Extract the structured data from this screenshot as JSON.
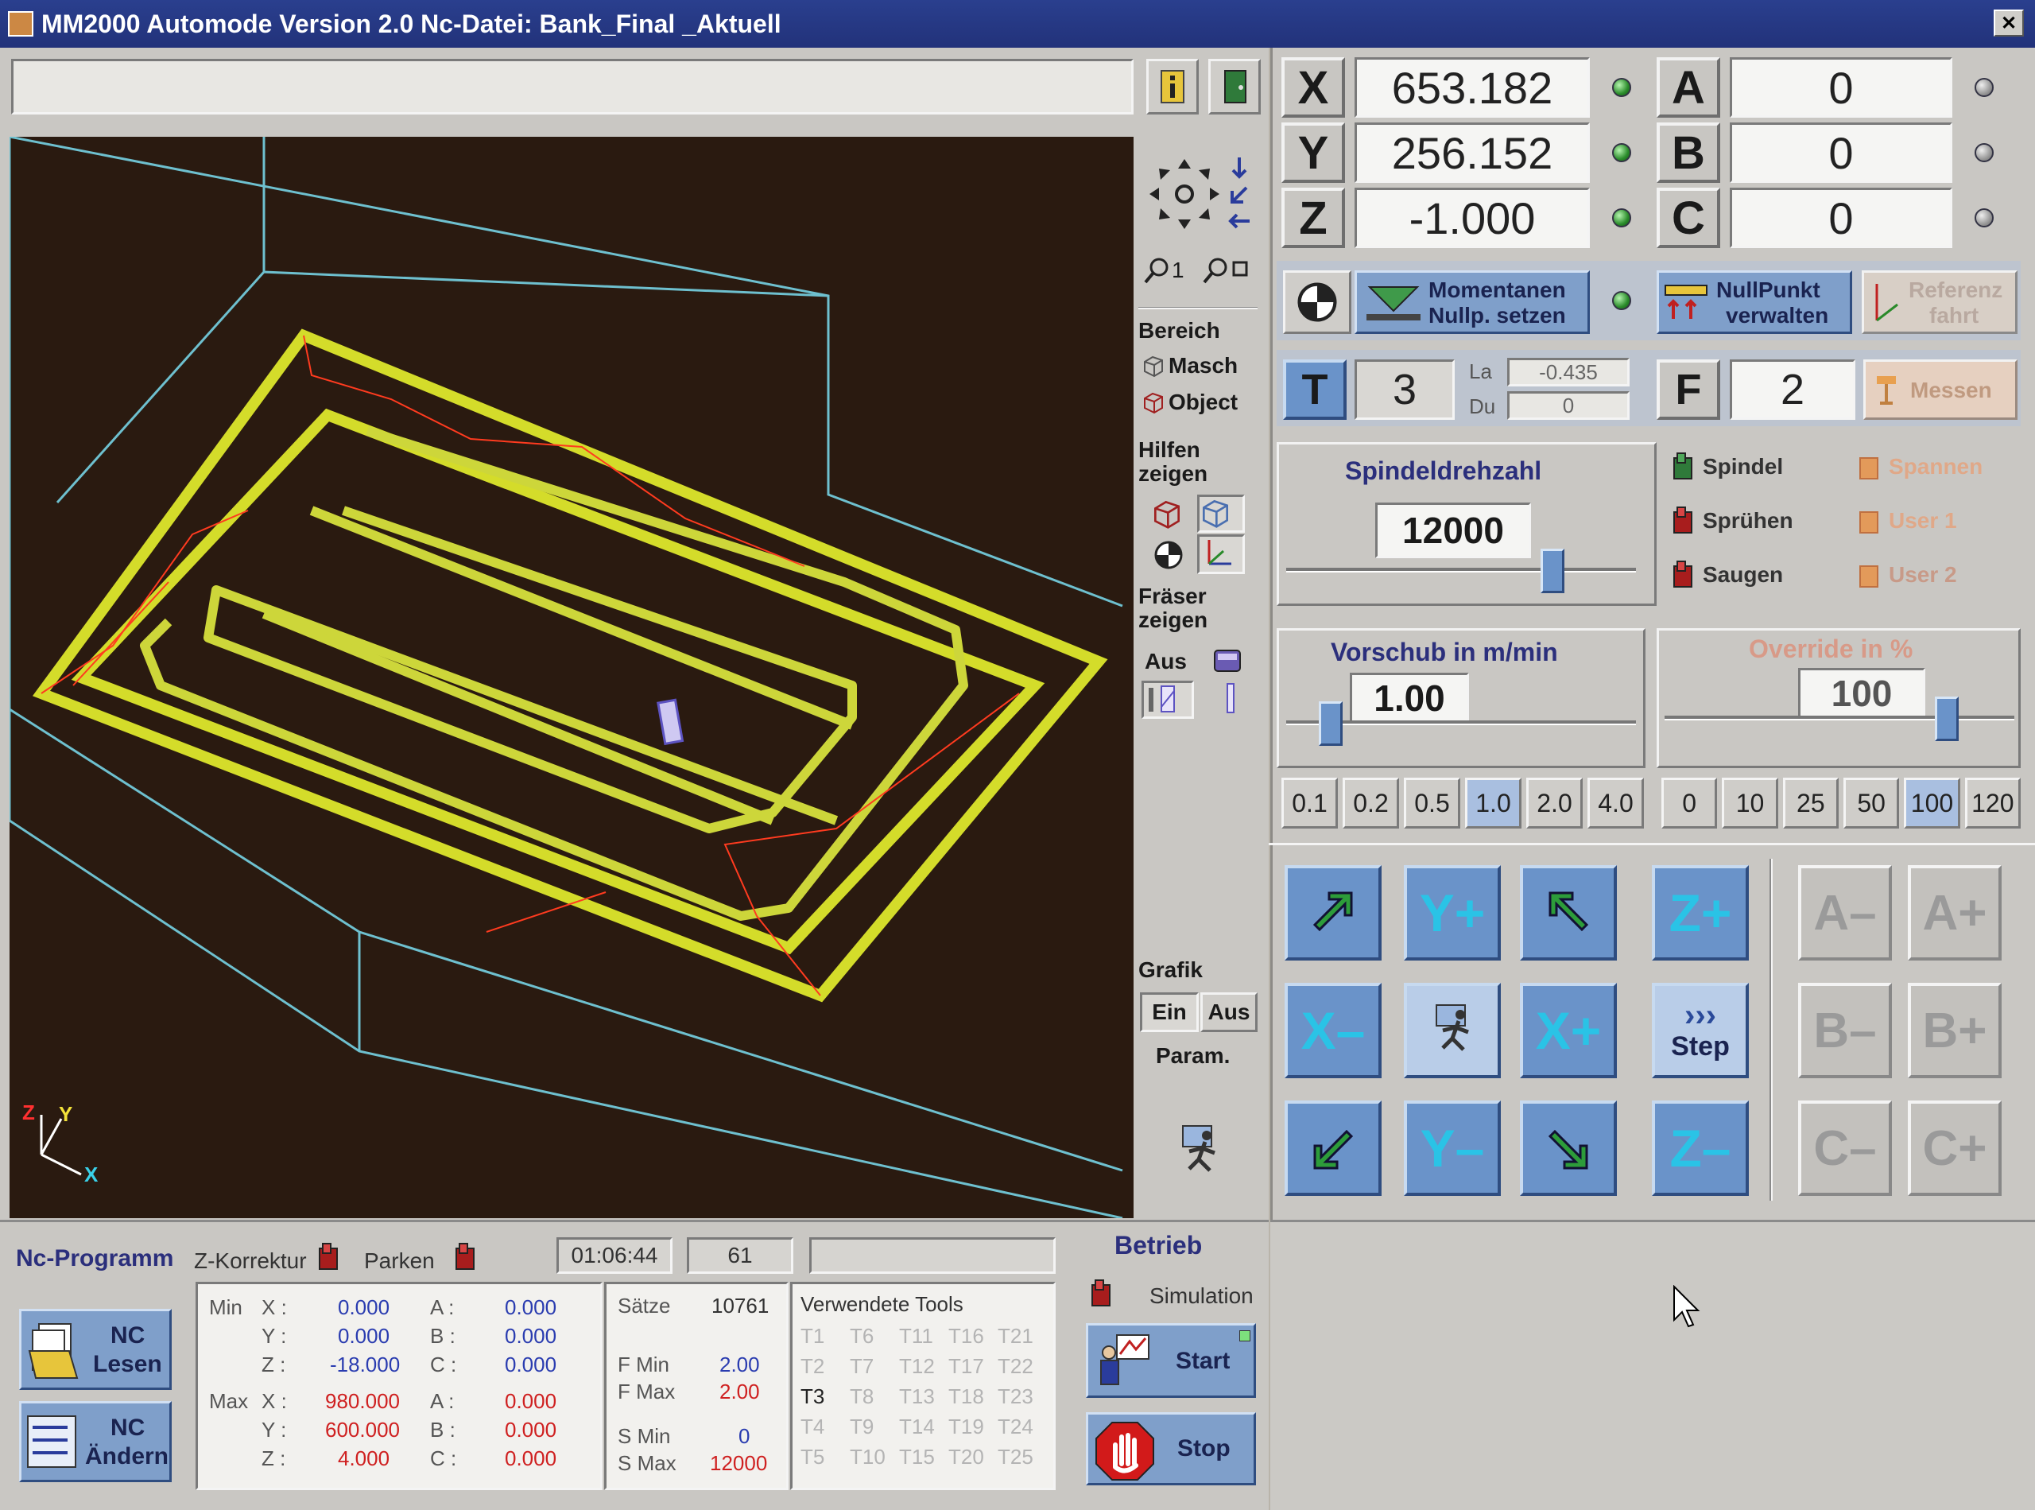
{
  "window": {
    "title": "MM2000 Automode Version 2.0 Nc-Datei: Bank_Final _Aktuell",
    "close_label": "✕"
  },
  "coords": {
    "x": {
      "label": "X",
      "value": "653.182"
    },
    "y": {
      "label": "Y",
      "value": "256.152"
    },
    "z": {
      "label": "Z",
      "value": "-1.000"
    },
    "a": {
      "label": "A",
      "value": "0"
    },
    "b": {
      "label": "B",
      "value": "0"
    },
    "c": {
      "label": "C",
      "value": "0"
    }
  },
  "zero": {
    "set_line1": "Momentanen",
    "set_line2": "Nullp. setzen",
    "manage_line1": "NullPunkt",
    "manage_line2": "verwalten",
    "ref_line1": "Referenz",
    "ref_line2": "fahrt"
  },
  "tool": {
    "t_label": "T",
    "t_value": "3",
    "la_label": "La",
    "la_value": "-0.435",
    "du_label": "Du",
    "du_value": "0",
    "f_label": "F",
    "f_value": "2",
    "measure_label": "Messen"
  },
  "spindle": {
    "title": "Spindeldrehzahl",
    "value": "12000",
    "slider_fraction": 0.78
  },
  "outputs": {
    "spindel": "Spindel",
    "spruehen": "Sprühen",
    "saugen": "Saugen",
    "spannen": "Spannen",
    "user1": "User 1",
    "user2": "User 2"
  },
  "feed": {
    "title": "Vorschub in m/min",
    "value": "1.00",
    "slider_fraction": 0.1,
    "presets": [
      "0.1",
      "0.2",
      "0.5",
      "1.0",
      "2.0",
      "4.0"
    ],
    "selected": "1.0"
  },
  "override": {
    "title": "Override in %",
    "value": "100",
    "slider_fraction": 0.83,
    "presets": [
      "0",
      "10",
      "25",
      "50",
      "100",
      "120"
    ],
    "selected": "100"
  },
  "jog": {
    "y_plus": "Y+",
    "y_minus": "Y–",
    "x_plus": "X+",
    "x_minus": "X–",
    "z_plus": "Z+",
    "z_minus": "Z–",
    "step_arrows": "›››",
    "step": "Step",
    "a_minus": "A–",
    "a_plus": "A+",
    "b_minus": "B–",
    "b_plus": "B+",
    "c_minus": "C–",
    "c_plus": "C+"
  },
  "view_tools": {
    "bereich": "Bereich",
    "masch": "Masch",
    "object": "Object",
    "hilfen1": "Hilfen",
    "hilfen2": "zeigen",
    "fraeser1": "Fräser",
    "fraeser2": "zeigen",
    "aus": "Aus",
    "zoom1": "1",
    "grafik": "Grafik",
    "ein": "Ein",
    "aus2": "Aus",
    "param": "Param."
  },
  "axis_labels": {
    "z": "Z",
    "y": "Y",
    "x": "X"
  },
  "nc": {
    "title": "Nc-Programm",
    "lesen1": "NC",
    "lesen2": "Lesen",
    "aendern1": "NC",
    "aendern2": "Ändern",
    "z_korrektur": "Z-Korrektur",
    "parken": "Parken",
    "time": "01:06:44",
    "count": "61",
    "min_label": "Min",
    "max_label": "Max",
    "min": {
      "x": "0.000",
      "y": "0.000",
      "z": "-18.000",
      "a": "0.000",
      "b": "0.000",
      "c": "0.000"
    },
    "max": {
      "x": "980.000",
      "y": "600.000",
      "z": "4.000",
      "a": "0.000",
      "b": "0.000",
      "c": "0.000"
    },
    "saetze_label": "Sätze",
    "saetze": "10761",
    "fmin_label": "F Min",
    "fmin": "2.00",
    "fmax_label": "F Max",
    "fmax": "2.00",
    "smin_label": "S Min",
    "smin": "0",
    "smax_label": "S Max",
    "smax": "12000",
    "tools_title": "Verwendete Tools",
    "tools": [
      [
        "T1",
        "T6",
        "T11",
        "T16",
        "T21"
      ],
      [
        "T2",
        "T7",
        "T12",
        "T17",
        "T22"
      ],
      [
        "T3",
        "T8",
        "T13",
        "T18",
        "T23"
      ],
      [
        "T4",
        "T9",
        "T14",
        "T19",
        "T24"
      ],
      [
        "T5",
        "T10",
        "T15",
        "T20",
        "T25"
      ]
    ],
    "active_tool": "T3"
  },
  "betrieb": {
    "title": "Betrieb",
    "simulation": "Simulation",
    "start": "Start",
    "stop": "Stop"
  }
}
